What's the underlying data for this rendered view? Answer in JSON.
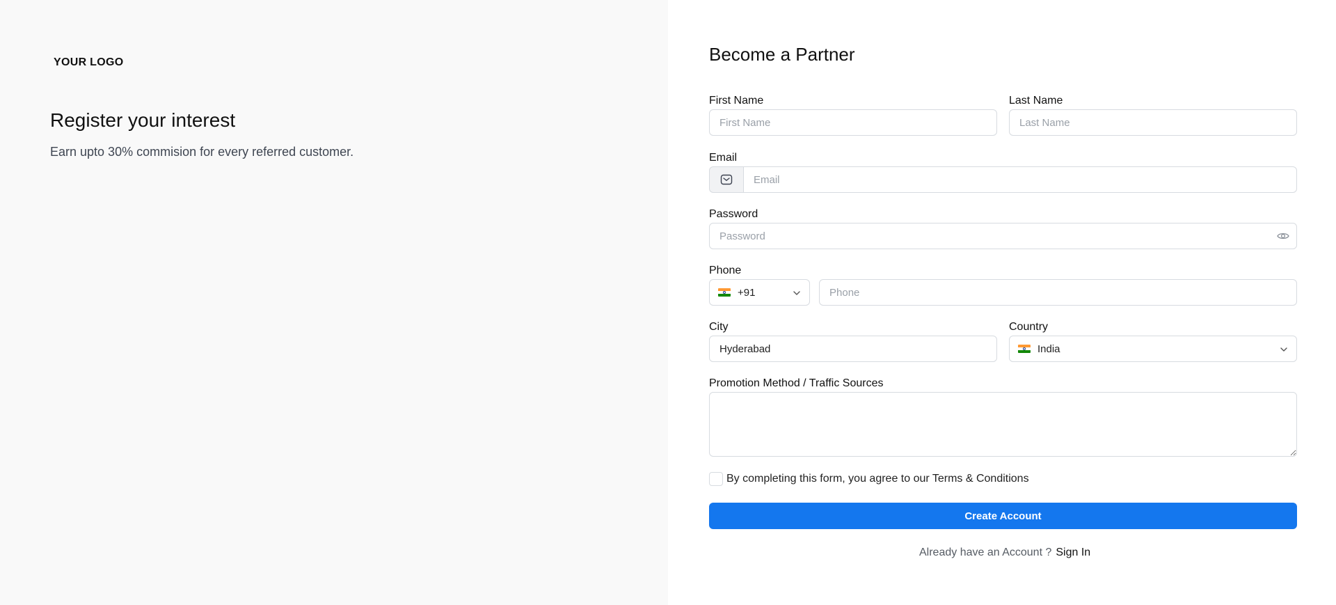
{
  "brand": {
    "logo_text": "YOUR LOGO"
  },
  "hero": {
    "title": "Register your interest",
    "subtitle": "Earn upto 30% commision for every referred customer."
  },
  "form": {
    "title": "Become a Partner",
    "first_name": {
      "label": "First Name",
      "placeholder": "First Name"
    },
    "last_name": {
      "label": "Last Name",
      "placeholder": "Last Name"
    },
    "email": {
      "label": "Email",
      "placeholder": "Email",
      "icon": "mail-icon"
    },
    "password": {
      "label": "Password",
      "placeholder": "Password",
      "icon": "eye-icon"
    },
    "phone": {
      "label": "Phone",
      "country_code": "+91",
      "placeholder": "Phone",
      "flag": "india-flag"
    },
    "city": {
      "label": "City",
      "value": "Hyderabad"
    },
    "country": {
      "label": "Country",
      "value": "India",
      "flag": "india-flag"
    },
    "promotion": {
      "label": "Promotion Method / Traffic Sources"
    },
    "agreement": {
      "text": "By completing this form, you agree to our Terms & Conditions"
    },
    "submit_label": "Create Account",
    "signin_prompt": "Already have an Account ?",
    "signin_link": "Sign In"
  },
  "colors": {
    "primary": "#1477ee",
    "left_panel_bg": "#f9f9f9",
    "border": "#d7dbe0",
    "flag_saffron": "#ff9933",
    "flag_green": "#138808"
  }
}
